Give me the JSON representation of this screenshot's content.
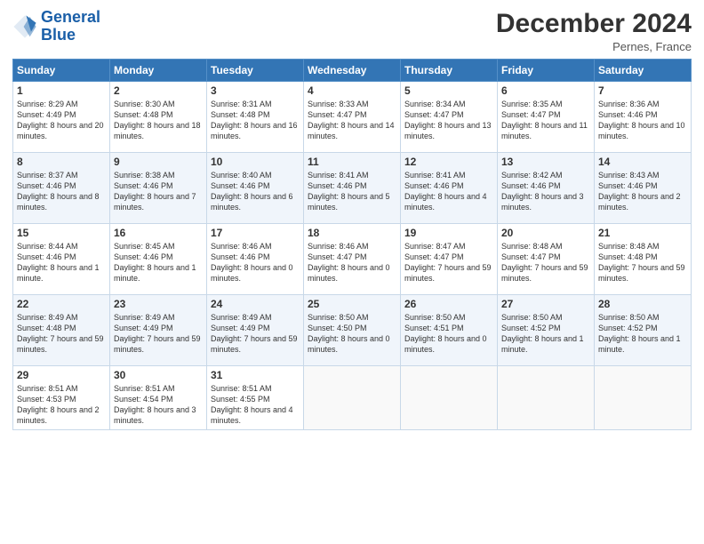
{
  "header": {
    "logo_line1": "General",
    "logo_line2": "Blue",
    "month_title": "December 2024",
    "location": "Pernes, France"
  },
  "days_of_week": [
    "Sunday",
    "Monday",
    "Tuesday",
    "Wednesday",
    "Thursday",
    "Friday",
    "Saturday"
  ],
  "weeks": [
    [
      {
        "day": "1",
        "sunrise": "8:29 AM",
        "sunset": "4:49 PM",
        "daylight": "8 hours and 20 minutes."
      },
      {
        "day": "2",
        "sunrise": "8:30 AM",
        "sunset": "4:48 PM",
        "daylight": "8 hours and 18 minutes."
      },
      {
        "day": "3",
        "sunrise": "8:31 AM",
        "sunset": "4:48 PM",
        "daylight": "8 hours and 16 minutes."
      },
      {
        "day": "4",
        "sunrise": "8:33 AM",
        "sunset": "4:47 PM",
        "daylight": "8 hours and 14 minutes."
      },
      {
        "day": "5",
        "sunrise": "8:34 AM",
        "sunset": "4:47 PM",
        "daylight": "8 hours and 13 minutes."
      },
      {
        "day": "6",
        "sunrise": "8:35 AM",
        "sunset": "4:47 PM",
        "daylight": "8 hours and 11 minutes."
      },
      {
        "day": "7",
        "sunrise": "8:36 AM",
        "sunset": "4:46 PM",
        "daylight": "8 hours and 10 minutes."
      }
    ],
    [
      {
        "day": "8",
        "sunrise": "8:37 AM",
        "sunset": "4:46 PM",
        "daylight": "8 hours and 8 minutes."
      },
      {
        "day": "9",
        "sunrise": "8:38 AM",
        "sunset": "4:46 PM",
        "daylight": "8 hours and 7 minutes."
      },
      {
        "day": "10",
        "sunrise": "8:40 AM",
        "sunset": "4:46 PM",
        "daylight": "8 hours and 6 minutes."
      },
      {
        "day": "11",
        "sunrise": "8:41 AM",
        "sunset": "4:46 PM",
        "daylight": "8 hours and 5 minutes."
      },
      {
        "day": "12",
        "sunrise": "8:41 AM",
        "sunset": "4:46 PM",
        "daylight": "8 hours and 4 minutes."
      },
      {
        "day": "13",
        "sunrise": "8:42 AM",
        "sunset": "4:46 PM",
        "daylight": "8 hours and 3 minutes."
      },
      {
        "day": "14",
        "sunrise": "8:43 AM",
        "sunset": "4:46 PM",
        "daylight": "8 hours and 2 minutes."
      }
    ],
    [
      {
        "day": "15",
        "sunrise": "8:44 AM",
        "sunset": "4:46 PM",
        "daylight": "8 hours and 1 minute."
      },
      {
        "day": "16",
        "sunrise": "8:45 AM",
        "sunset": "4:46 PM",
        "daylight": "8 hours and 1 minute."
      },
      {
        "day": "17",
        "sunrise": "8:46 AM",
        "sunset": "4:46 PM",
        "daylight": "8 hours and 0 minutes."
      },
      {
        "day": "18",
        "sunrise": "8:46 AM",
        "sunset": "4:47 PM",
        "daylight": "8 hours and 0 minutes."
      },
      {
        "day": "19",
        "sunrise": "8:47 AM",
        "sunset": "4:47 PM",
        "daylight": "7 hours and 59 minutes."
      },
      {
        "day": "20",
        "sunrise": "8:48 AM",
        "sunset": "4:47 PM",
        "daylight": "7 hours and 59 minutes."
      },
      {
        "day": "21",
        "sunrise": "8:48 AM",
        "sunset": "4:48 PM",
        "daylight": "7 hours and 59 minutes."
      }
    ],
    [
      {
        "day": "22",
        "sunrise": "8:49 AM",
        "sunset": "4:48 PM",
        "daylight": "7 hours and 59 minutes."
      },
      {
        "day": "23",
        "sunrise": "8:49 AM",
        "sunset": "4:49 PM",
        "daylight": "7 hours and 59 minutes."
      },
      {
        "day": "24",
        "sunrise": "8:49 AM",
        "sunset": "4:49 PM",
        "daylight": "7 hours and 59 minutes."
      },
      {
        "day": "25",
        "sunrise": "8:50 AM",
        "sunset": "4:50 PM",
        "daylight": "8 hours and 0 minutes."
      },
      {
        "day": "26",
        "sunrise": "8:50 AM",
        "sunset": "4:51 PM",
        "daylight": "8 hours and 0 minutes."
      },
      {
        "day": "27",
        "sunrise": "8:50 AM",
        "sunset": "4:52 PM",
        "daylight": "8 hours and 1 minute."
      },
      {
        "day": "28",
        "sunrise": "8:50 AM",
        "sunset": "4:52 PM",
        "daylight": "8 hours and 1 minute."
      }
    ],
    [
      {
        "day": "29",
        "sunrise": "8:51 AM",
        "sunset": "4:53 PM",
        "daylight": "8 hours and 2 minutes."
      },
      {
        "day": "30",
        "sunrise": "8:51 AM",
        "sunset": "4:54 PM",
        "daylight": "8 hours and 3 minutes."
      },
      {
        "day": "31",
        "sunrise": "8:51 AM",
        "sunset": "4:55 PM",
        "daylight": "8 hours and 4 minutes."
      },
      null,
      null,
      null,
      null
    ]
  ]
}
